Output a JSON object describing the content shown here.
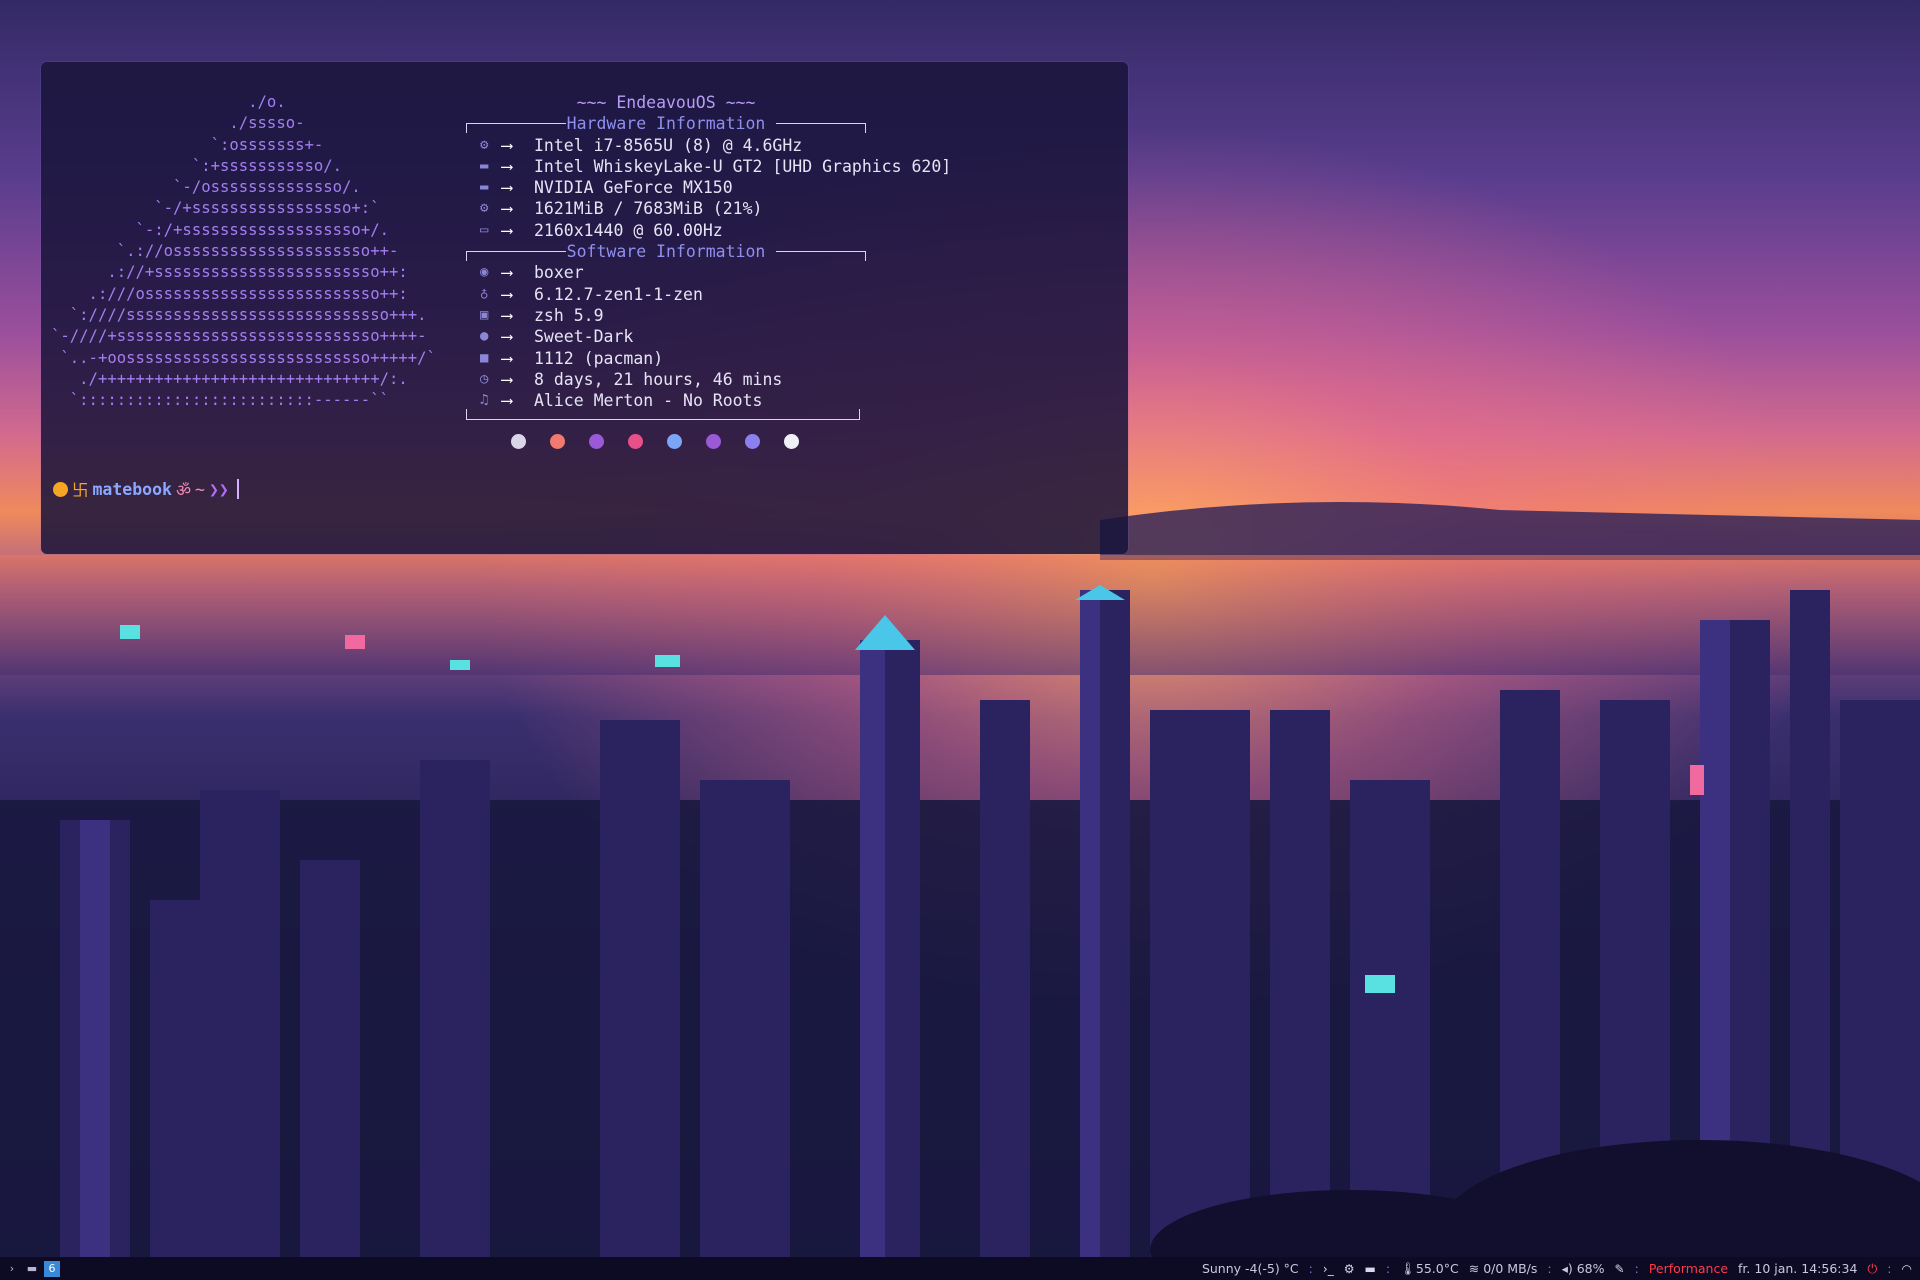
{
  "terminal": {
    "ascii_logo": [
      "                     ./o.",
      "                   ./sssso-",
      "                 `:osssssss+-",
      "               `:+sssssssssso/.",
      "             `-/ossssssssssssso/.",
      "           `-/+sssssssssssssssso+:`",
      "         `-:/+sssssssssssssssssso+/.",
      "       `.://osssssssssssssssssssso++-",
      "      .://+ssssssssssssssssssssssso++:",
      "    .:///osssssssssssssssssssssssso++:",
      "  `:////ssssssssssssssssssssssssssso+++.",
      "`-////+ssssssssssssssssssssssssssso++++-",
      " `..-+oossssssssssssssssssssssssso+++++/`",
      "   ./++++++++++++++++++++++++++++++/:.",
      "  `:::::::::::::::::::::::::------``"
    ],
    "distro_title": "~~~ EndeavouOS ~~~",
    "hardware_header": "Hardware Information",
    "software_header": "Software Information",
    "arrow": "⟶",
    "hardware": [
      {
        "icon": "cpu-icon",
        "glyph": "⚙",
        "value": "Intel i7-8565U (8) @ 4.6GHz"
      },
      {
        "icon": "gpu-icon",
        "glyph": "▬",
        "value": "Intel WhiskeyLake-U GT2 [UHD Graphics 620]"
      },
      {
        "icon": "gpu-icon",
        "glyph": "▬",
        "value": "NVIDIA GeForce MX150"
      },
      {
        "icon": "memory-icon",
        "glyph": "⚙",
        "value": "1621MiB / 7683MiB (21%)"
      },
      {
        "icon": "display-icon",
        "glyph": "▭",
        "value": "2160x1440 @ 60.00Hz"
      }
    ],
    "software": [
      {
        "icon": "user-icon",
        "glyph": "◉",
        "value": "boxer"
      },
      {
        "icon": "kernel-icon",
        "glyph": "♁",
        "value": "6.12.7-zen1-1-zen"
      },
      {
        "icon": "shell-icon",
        "glyph": "▣",
        "value": "zsh 5.9"
      },
      {
        "icon": "theme-icon",
        "glyph": "●",
        "value": "Sweet-Dark"
      },
      {
        "icon": "package-icon",
        "glyph": "■",
        "value": "1112 (pacman)"
      },
      {
        "icon": "clock-icon",
        "glyph": "◷",
        "value": "8 days, 21 hours, 46 mins"
      },
      {
        "icon": "music-icon",
        "glyph": "♫",
        "value": "Alice Merton - No Roots"
      }
    ],
    "color_dots": [
      "#d8d6e8",
      "#f07a70",
      "#9a5ad8",
      "#e8508a",
      "#7aa6f5",
      "#9a5ad8",
      "#8a80f0",
      "#f0f0f5"
    ],
    "prompt": {
      "symbol": "卐",
      "host": "matebook",
      "om": "ॐ",
      "tilde": "~",
      "arrows": "❯❯"
    }
  },
  "taskbar": {
    "workspace_icons": [
      "terminal-icon",
      "folder-icon"
    ],
    "active_workspace": "6",
    "weather": "Sunny -4(-5) °C",
    "temperature": "55.0°C",
    "network": "0/0 MB/s",
    "volume": "68%",
    "power_profile": "Performance",
    "datetime": "fr. 10 jan. 14:56:34",
    "separator": ":"
  },
  "colors": {
    "accent": "#a37ef0",
    "terminal_bg": "#18143a",
    "taskbar_bg": "#0d0b24",
    "performance": "#ff3a4a"
  }
}
